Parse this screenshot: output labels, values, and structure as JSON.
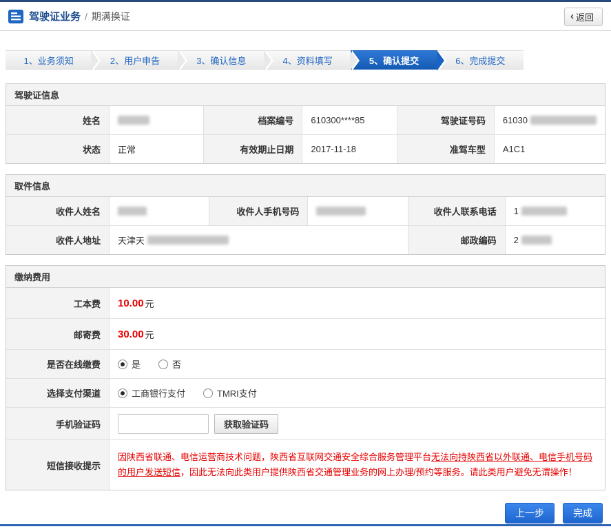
{
  "colors": {
    "accent_blue": "#1a64c8",
    "warning_red": "#e60000",
    "button_blue": "#2b7de1",
    "top_bar": "#2a4a7b"
  },
  "header": {
    "title": "驾驶证业务",
    "separator": "/",
    "subtitle": "期满换证",
    "back_chevron": "‹",
    "back_label": "返回"
  },
  "steps": {
    "active_index": 4,
    "items": [
      {
        "label": "1、业务须知"
      },
      {
        "label": "2、用户申告"
      },
      {
        "label": "3、确认信息"
      },
      {
        "label": "4、资料填写"
      },
      {
        "label": "5、确认提交"
      },
      {
        "label": "6、完成提交"
      }
    ]
  },
  "license": {
    "title": "驾驶证信息",
    "fields": {
      "name_label": "姓名",
      "file_no_label": "档案编号",
      "file_no_value": "610300****85",
      "license_no_label": "驾驶证号码",
      "license_no_value": "61030",
      "status_label": "状态",
      "status_value": "正常",
      "expiry_label": "有效期止日期",
      "expiry_value": "2017-11-18",
      "vehicle_label": "准驾车型",
      "vehicle_value": "A1C1"
    }
  },
  "pickup": {
    "title": "取件信息",
    "fields": {
      "recipient_name_label": "收件人姓名",
      "recipient_mobile_label": "收件人手机号码",
      "recipient_phone_label": "收件人联系电话",
      "recipient_phone_value": "1",
      "address_label": "收件人地址",
      "address_value": "天津天",
      "postcode_label": "邮政编码",
      "postcode_value": "2"
    }
  },
  "fees": {
    "title": "缴纳费用",
    "cost_label": "工本费",
    "cost_value": "10.00",
    "cost_unit": "元",
    "postage_label": "邮寄费",
    "postage_value": "30.00",
    "postage_unit": "元",
    "online_pay_label": "是否在线缴费",
    "online_pay_options": [
      {
        "label": "是",
        "selected": true
      },
      {
        "label": "否",
        "selected": false
      }
    ],
    "channel_label": "选择支付渠道",
    "channel_options": [
      {
        "label": "工商银行支付",
        "selected": true
      },
      {
        "label": "TMRI支付",
        "selected": false
      }
    ],
    "captcha_label": "手机验证码",
    "captcha_button": "获取验证码",
    "sms_tip_label": "短信接收提示",
    "sms_tip_pre": "因陕西省联通、电信运营商技术问题，陕西省互联网交通安全综合服务管理平台",
    "sms_tip_underline": "无法向持陕西省以外联通、电信手机号码的用户发送短信",
    "sms_tip_post": "，因此无法向此类用户提供陕西省交通管理业务的网上办理/预约等服务。请此类用户避免无谓操作！"
  },
  "actions": {
    "prev": "上一步",
    "finish": "完成"
  }
}
